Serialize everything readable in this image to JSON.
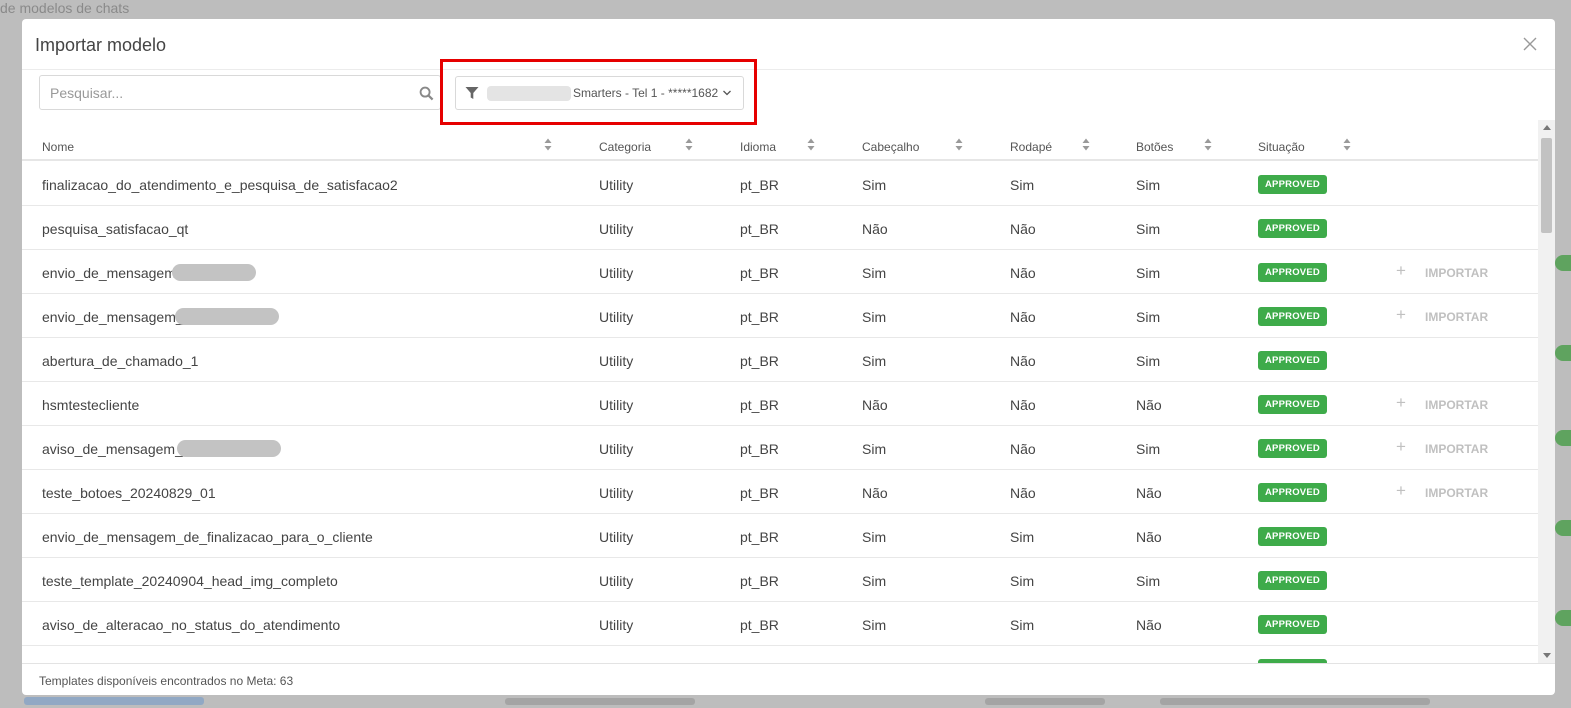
{
  "background": {
    "title": "de modelos de chats"
  },
  "modal": {
    "title": "Importar modelo",
    "search_placeholder": "Pesquisar...",
    "filter_label": "Smarters - Tel 1 - *****1682",
    "footer_text": "Templates disponíveis encontrados no Meta: 63",
    "import_label": "IMPORTAR"
  },
  "table": {
    "headers": [
      "Nome",
      "Categoria",
      "Idioma",
      "Cabeçalho",
      "Rodapé",
      "Botões",
      "Situação"
    ],
    "rows": [
      {
        "name": "finalizacao_do_atendimento_e_pesquisa_de_satisfacao2",
        "categoria": "Utility",
        "idioma": "pt_BR",
        "cabecalho": "Sim",
        "rodape": "Sim",
        "botoes": "Sim",
        "situacao": "APPROVED",
        "importar": false
      },
      {
        "name": "pesquisa_satisfacao_qt",
        "categoria": "Utility",
        "idioma": "pt_BR",
        "cabecalho": "Não",
        "rodape": "Não",
        "botoes": "Sim",
        "situacao": "APPROVED",
        "importar": false
      },
      {
        "name": "envio_de_mensagem",
        "categoria": "Utility",
        "idioma": "pt_BR",
        "cabecalho": "Sim",
        "rodape": "Não",
        "botoes": "Sim",
        "situacao": "APPROVED",
        "importar": true
      },
      {
        "name": "envio_de_mensagem_",
        "categoria": "Utility",
        "idioma": "pt_BR",
        "cabecalho": "Sim",
        "rodape": "Não",
        "botoes": "Sim",
        "situacao": "APPROVED",
        "importar": true
      },
      {
        "name": "abertura_de_chamado_1",
        "categoria": "Utility",
        "idioma": "pt_BR",
        "cabecalho": "Sim",
        "rodape": "Não",
        "botoes": "Sim",
        "situacao": "APPROVED",
        "importar": false
      },
      {
        "name": "hsmtestecliente",
        "categoria": "Utility",
        "idioma": "pt_BR",
        "cabecalho": "Não",
        "rodape": "Não",
        "botoes": "Não",
        "situacao": "APPROVED",
        "importar": true
      },
      {
        "name": "aviso_de_mensagem_",
        "categoria": "Utility",
        "idioma": "pt_BR",
        "cabecalho": "Sim",
        "rodape": "Não",
        "botoes": "Sim",
        "situacao": "APPROVED",
        "importar": true
      },
      {
        "name": "teste_botoes_20240829_01",
        "categoria": "Utility",
        "idioma": "pt_BR",
        "cabecalho": "Não",
        "rodape": "Não",
        "botoes": "Não",
        "situacao": "APPROVED",
        "importar": true
      },
      {
        "name": "envio_de_mensagem_de_finalizacao_para_o_cliente",
        "categoria": "Utility",
        "idioma": "pt_BR",
        "cabecalho": "Sim",
        "rodape": "Sim",
        "botoes": "Não",
        "situacao": "APPROVED",
        "importar": false
      },
      {
        "name": "teste_template_20240904_head_img_completo",
        "categoria": "Utility",
        "idioma": "pt_BR",
        "cabecalho": "Sim",
        "rodape": "Sim",
        "botoes": "Sim",
        "situacao": "APPROVED",
        "importar": false
      },
      {
        "name": "aviso_de_alteracao_no_status_do_atendimento",
        "categoria": "Utility",
        "idioma": "pt_BR",
        "cabecalho": "Sim",
        "rodape": "Sim",
        "botoes": "Não",
        "situacao": "APPROVED",
        "importar": false
      },
      {
        "name": "",
        "categoria": "",
        "idioma": "",
        "cabecalho": "",
        "rodape": "",
        "botoes": "",
        "situacao": "APPROVED",
        "importar": false
      }
    ]
  },
  "colors": {
    "approved": "#3eab4a",
    "highlight": "#e60000"
  },
  "icons": {
    "close": "close-icon",
    "search": "search-icon",
    "filter": "filter-icon",
    "dropdown": "chevron-down-icon",
    "sort": "sort-icon",
    "add": "plus-icon"
  }
}
